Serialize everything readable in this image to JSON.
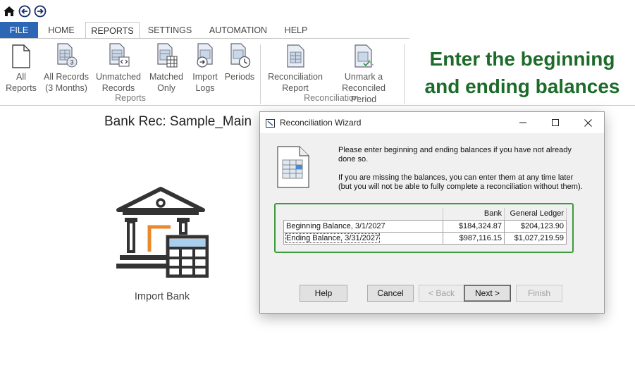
{
  "quick_access": {
    "home": "home-icon",
    "back": "back-arrow-icon",
    "forward": "forward-arrow-icon"
  },
  "tabs": [
    "FILE",
    "HOME",
    "REPORTS",
    "SETTINGS",
    "AUTOMATION",
    "HELP"
  ],
  "ribbon": {
    "reports_group": {
      "label": "Reports",
      "buttons": [
        {
          "line1": "All",
          "line2": "Reports"
        },
        {
          "line1": "All Records",
          "line2": "(3 Months)"
        },
        {
          "line1": "Unmatched",
          "line2": "Records"
        },
        {
          "line1": "Matched",
          "line2": "Only"
        },
        {
          "line1": "Import",
          "line2": "Logs"
        },
        {
          "line1": "Periods",
          "line2": ""
        }
      ]
    },
    "reconciliation_group": {
      "label": "Reconciliation",
      "buttons": [
        {
          "line1": "Reconciliation",
          "line2": "Report"
        },
        {
          "line1": "Unmark a",
          "line2": "Reconciled Period"
        }
      ]
    }
  },
  "callout": {
    "line1": "Enter the beginning",
    "line2": "and ending balances"
  },
  "page_title": "Bank Rec: Sample_Main",
  "import_label": "Import Bank",
  "dialog": {
    "title": "Reconciliation Wizard",
    "message1_line1": "Please enter beginning and ending balances if you have not already",
    "message1_line2": "done so.",
    "message2_line1": "If you are missing the balances, you can enter them at any time later",
    "message2_line2": "(but you will not be able to fully complete a reconciliation without them).",
    "grid": {
      "headers": [
        "",
        "Bank",
        "General Ledger"
      ],
      "rows": [
        {
          "label": "Beginning Balance, 3/1/2027",
          "bank": "$184,324.87",
          "gl": "$204,123.90"
        },
        {
          "label": "Ending Balance, 3/31/2027",
          "bank": "$987,116.15",
          "gl": "$1,027,219.59"
        }
      ]
    },
    "buttons": {
      "help": "Help",
      "cancel": "Cancel",
      "back": "< Back",
      "next": "Next >",
      "finish": "Finish"
    }
  },
  "colors": {
    "file_tab": "#2b67b5",
    "callout_text": "#1d6b2a",
    "highlight_border": "#3e9a3e",
    "bank_icon_accent": "#e8892b",
    "bank_icon_calc": "#a8d0ee"
  }
}
